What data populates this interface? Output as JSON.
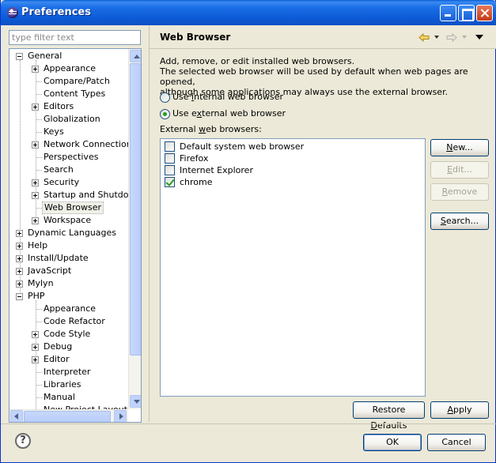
{
  "window": {
    "title": "Preferences",
    "colors": {
      "titlebar": "#0d5bd6",
      "face": "#ece9d8",
      "check": "#21a121"
    }
  },
  "filter": {
    "placeholder": "type filter text",
    "value": ""
  },
  "tree": {
    "items": [
      {
        "label": "General",
        "level": 0,
        "expander": "minus"
      },
      {
        "label": "Appearance",
        "level": 1,
        "expander": "plus"
      },
      {
        "label": "Compare/Patch",
        "level": 1,
        "expander": "none"
      },
      {
        "label": "Content Types",
        "level": 1,
        "expander": "none"
      },
      {
        "label": "Editors",
        "level": 1,
        "expander": "plus"
      },
      {
        "label": "Globalization",
        "level": 1,
        "expander": "none"
      },
      {
        "label": "Keys",
        "level": 1,
        "expander": "none"
      },
      {
        "label": "Network Connections",
        "level": 1,
        "expander": "plus"
      },
      {
        "label": "Perspectives",
        "level": 1,
        "expander": "none"
      },
      {
        "label": "Search",
        "level": 1,
        "expander": "none"
      },
      {
        "label": "Security",
        "level": 1,
        "expander": "plus"
      },
      {
        "label": "Startup and Shutdown",
        "level": 1,
        "expander": "plus"
      },
      {
        "label": "Web Browser",
        "level": 1,
        "expander": "none",
        "selected": true
      },
      {
        "label": "Workspace",
        "level": 1,
        "expander": "plus"
      },
      {
        "label": "Dynamic Languages",
        "level": 0,
        "expander": "plus"
      },
      {
        "label": "Help",
        "level": 0,
        "expander": "plus"
      },
      {
        "label": "Install/Update",
        "level": 0,
        "expander": "plus"
      },
      {
        "label": "JavaScript",
        "level": 0,
        "expander": "plus"
      },
      {
        "label": "Mylyn",
        "level": 0,
        "expander": "plus"
      },
      {
        "label": "PHP",
        "level": 0,
        "expander": "minus"
      },
      {
        "label": "Appearance",
        "level": 1,
        "expander": "none"
      },
      {
        "label": "Code Refactor",
        "level": 1,
        "expander": "none"
      },
      {
        "label": "Code Style",
        "level": 1,
        "expander": "plus"
      },
      {
        "label": "Debug",
        "level": 1,
        "expander": "plus"
      },
      {
        "label": "Editor",
        "level": 1,
        "expander": "plus"
      },
      {
        "label": "Interpreter",
        "level": 1,
        "expander": "none"
      },
      {
        "label": "Libraries",
        "level": 1,
        "expander": "none"
      },
      {
        "label": "Manual",
        "level": 1,
        "expander": "none"
      },
      {
        "label": "New Project Layout",
        "level": 1,
        "expander": "none"
      }
    ]
  },
  "page": {
    "title": "Web Browser",
    "description_lines": [
      "Add, remove, or edit installed web browsers.",
      "The selected web browser will be used by default when web pages are opened,",
      "although some applications may always use the external browser."
    ],
    "radio_internal": {
      "pre": "Use ",
      "key": "i",
      "post": "nternal web browser",
      "checked": false
    },
    "radio_external": {
      "pre": "Use e",
      "key": "x",
      "post": "ternal web browser",
      "checked": true
    },
    "external_label": {
      "pre": "External ",
      "key": "w",
      "post": "eb browsers:"
    },
    "browsers": [
      {
        "label": "Default system web browser",
        "checked": false
      },
      {
        "label": "Firefox",
        "checked": false
      },
      {
        "label": "Internet Explorer",
        "checked": false
      },
      {
        "label": "chrome",
        "checked": true
      }
    ],
    "buttons": {
      "new": {
        "key": "N",
        "rest": "ew..."
      },
      "edit": {
        "key": "E",
        "rest": "dit..."
      },
      "remove": {
        "key": "R",
        "rest": "emove"
      },
      "search": {
        "key": "S",
        "rest": "earch..."
      },
      "restore_defaults": {
        "pre": "Restore ",
        "key": "D",
        "post": "efaults"
      },
      "apply": {
        "key": "A",
        "rest": "pply"
      }
    }
  },
  "dialog": {
    "ok": "OK",
    "cancel": "Cancel",
    "help_glyph": "?"
  }
}
